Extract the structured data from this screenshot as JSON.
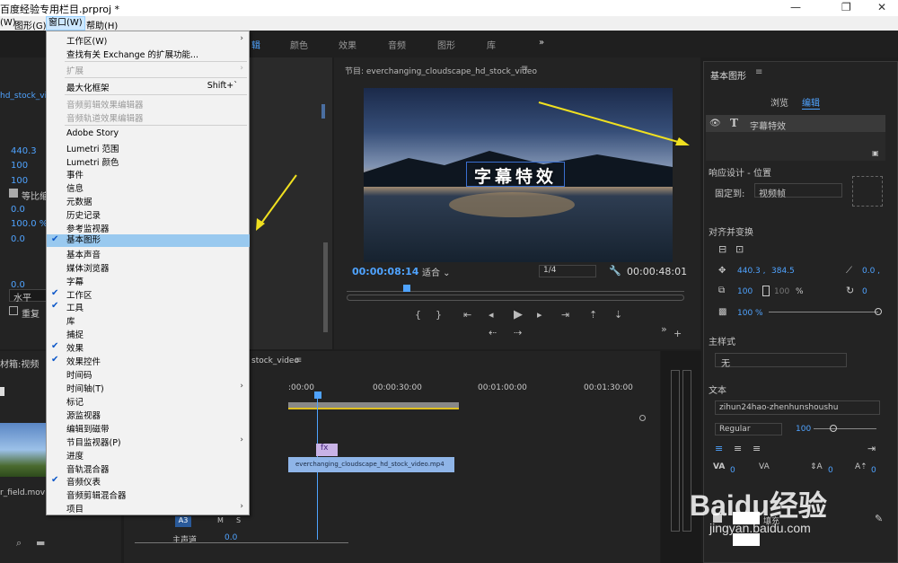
{
  "window": {
    "title": "百度经验专用栏目.prproj *",
    "controls": {
      "min": "—",
      "restore": "❐",
      "close": "✕"
    }
  },
  "menubar": [
    {
      "label": "(W)"
    },
    {
      "label": "图形(G)"
    },
    {
      "label": "窗口(W)"
    },
    {
      "label": "帮助(H)"
    }
  ],
  "window_menu": [
    {
      "label": "工作区(W)",
      "submenu": true
    },
    {
      "label": "查找有关 Exchange 的扩展功能..."
    },
    {
      "label": "扩展",
      "disabled": true,
      "submenu": true
    },
    {
      "label": "最大化框架",
      "shortcut": "Shift+`"
    },
    {
      "label": "音频剪辑效果编辑器",
      "disabled": true
    },
    {
      "label": "音频轨道效果编辑器",
      "disabled": true
    },
    {
      "label": "Adobe Story"
    },
    {
      "label": "Lumetri 范围"
    },
    {
      "label": "Lumetri 颜色"
    },
    {
      "label": "事件"
    },
    {
      "label": "信息"
    },
    {
      "label": "元数据"
    },
    {
      "label": "历史记录"
    },
    {
      "label": "参考监视器"
    },
    {
      "label": "基本图形",
      "checked": true,
      "highlighted": true
    },
    {
      "label": "基本声音"
    },
    {
      "label": "媒体浏览器"
    },
    {
      "label": "字幕"
    },
    {
      "label": "工作区",
      "checked": true
    },
    {
      "label": "工具",
      "checked": true
    },
    {
      "label": "库"
    },
    {
      "label": "捕捉"
    },
    {
      "label": "效果",
      "checked": true
    },
    {
      "label": "效果控件",
      "checked": true
    },
    {
      "label": "时间码"
    },
    {
      "label": "时间轴(T)",
      "submenu": true
    },
    {
      "label": "标记"
    },
    {
      "label": "源监视器"
    },
    {
      "label": "编辑到磁带"
    },
    {
      "label": "节目监视器(P)",
      "submenu": true
    },
    {
      "label": "进度"
    },
    {
      "label": "音轨混合器"
    },
    {
      "label": "音频仪表",
      "checked": true
    },
    {
      "label": "音频剪辑混合器"
    },
    {
      "label": "项目"
    }
  ],
  "workspace_tabs": [
    "辑",
    "颜色",
    "效果",
    "音频",
    "图形",
    "库",
    "»"
  ],
  "left_panel": {
    "clip_name": "hd_stock_vide",
    "values": [
      "440.3",
      "100",
      "100",
      "0.0",
      "等比缩",
      "0.0",
      "100.0 %",
      "0.0",
      "水平",
      "重复"
    ],
    "project_label": "材箱:视频",
    "file_name": "r_field.mov"
  },
  "program_monitor": {
    "title": "节目: everchanging_cloudscape_hd_stock_video",
    "title_text": "字幕特效",
    "timecode": "00:00:08:14",
    "fit": "适合",
    "quality": "1/4",
    "duration": "00:00:48:01"
  },
  "timeline": {
    "title": "stock_video",
    "ruler": [
      ":00:00",
      "00:00:30:00",
      "00:01:00:00",
      "00:01:30:00"
    ],
    "clip_label": "everchanging_cloudscape_hd_stock_video.mp4",
    "fx_label": "fx",
    "track_a3": "A3",
    "track_master": "主声道",
    "master_value": "0.0",
    "track_buttons": [
      "M",
      "S"
    ]
  },
  "essential_graphics": {
    "title": "基本图形",
    "tab_browse": "浏览",
    "tab_edit": "编辑",
    "layer_name": "字幕特效",
    "responsive_label": "响应设计 - 位置",
    "pin_label": "固定到:",
    "pin_value": "视频帧",
    "align_label": "对齐并变换",
    "pos_x": "440.3 ,",
    "pos_y": "384.5",
    "anchor": "0.0 ,",
    "scale": "100",
    "scale_pct": "%",
    "scale_h": "100",
    "rotation": "0",
    "opacity": "100 %",
    "style_label": "主样式",
    "style_value": "无",
    "text_label": "文本",
    "font": "zihun24hao-zhenhunshoushu",
    "weight": "Regular",
    "size": "100",
    "tracking": "0",
    "kerning": "0",
    "leading": "0",
    "baseline": "0",
    "appearance_label": "填充"
  },
  "watermark": {
    "brand": "Baidu经验",
    "url": "jingyan.baidu.com"
  },
  "colors": {
    "accent": "#4fa3ff",
    "menu_highlight": "#99c9ef",
    "annotation_arrow": "#f0e020",
    "clip": "#8fb5e8"
  }
}
